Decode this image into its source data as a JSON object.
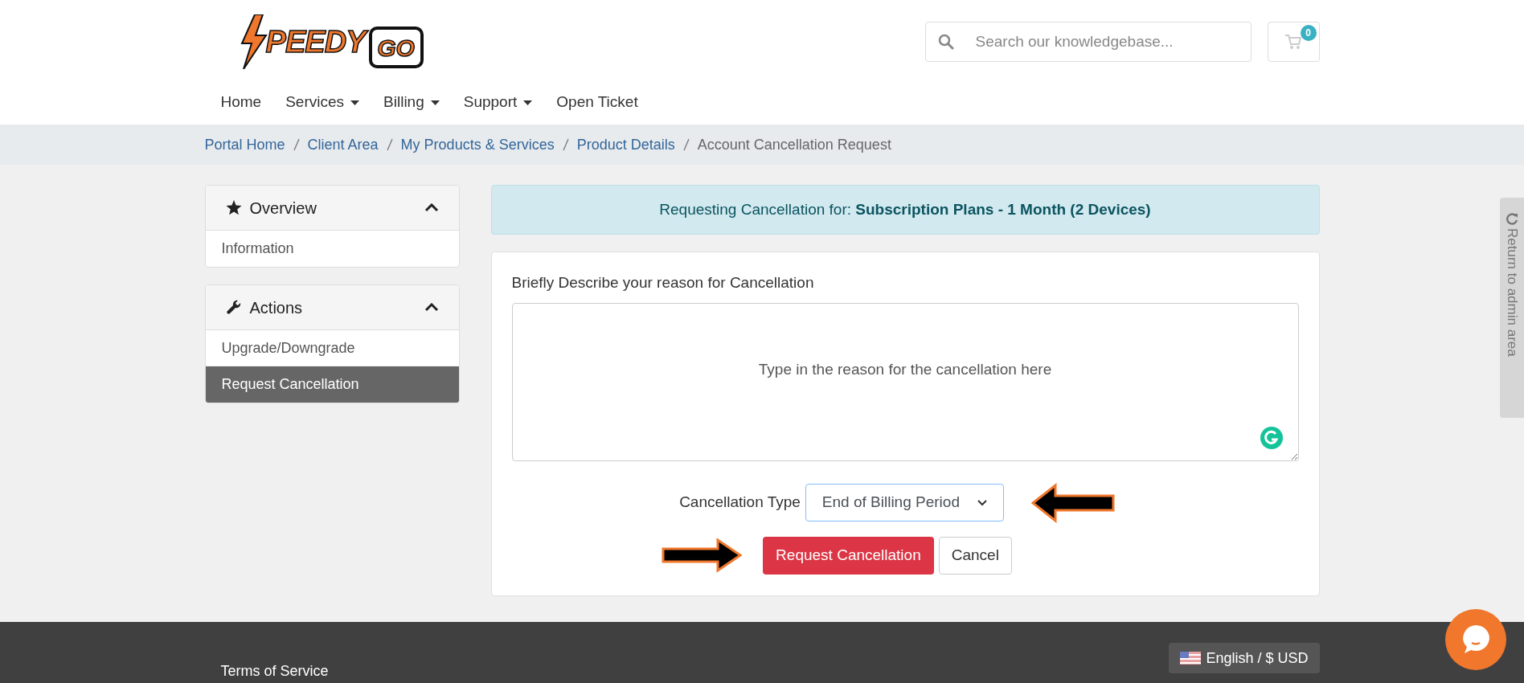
{
  "logo": {
    "word": "PEEDY",
    "tv_word": "GO"
  },
  "search": {
    "placeholder": "Search our knowledgebase..."
  },
  "cart": {
    "count": "0"
  },
  "nav": [
    {
      "label": "Home",
      "dropdown": false
    },
    {
      "label": "Services",
      "dropdown": true
    },
    {
      "label": "Billing",
      "dropdown": true
    },
    {
      "label": "Support",
      "dropdown": true
    },
    {
      "label": "Open Ticket",
      "dropdown": false
    }
  ],
  "breadcrumb": [
    {
      "label": "Portal Home",
      "link": true
    },
    {
      "label": "Client Area",
      "link": true
    },
    {
      "label": "My Products & Services",
      "link": true
    },
    {
      "label": "Product Details",
      "link": true
    },
    {
      "label": "Account Cancellation Request",
      "link": false
    }
  ],
  "sidebar": [
    {
      "title": "Overview",
      "kind": "star",
      "expanded": true,
      "items": [
        {
          "label": "Information",
          "selected": false
        }
      ]
    },
    {
      "title": "Actions",
      "kind": "wrench",
      "expanded": true,
      "items": [
        {
          "label": "Upgrade/Downgrade",
          "selected": false
        },
        {
          "label": "Request Cancellation",
          "selected": true
        }
      ]
    }
  ],
  "alert": "Requesting Cancellation for: **Subscription Plans - 1 Month (2 Devices)**",
  "form": {
    "reason_label": "Briefly Describe your reason for Cancellation",
    "reason_placeholder": "Type in the reason for the cancellation here",
    "type_label": "Cancellation Type",
    "type_value": "End of Billing Period",
    "submit": "Request Cancellation",
    "cancel": "Cancel"
  },
  "admin_tab": "Return to admin area",
  "footer": {
    "links": [
      "Terms of Service"
    ],
    "language": "English / $ USD"
  }
}
